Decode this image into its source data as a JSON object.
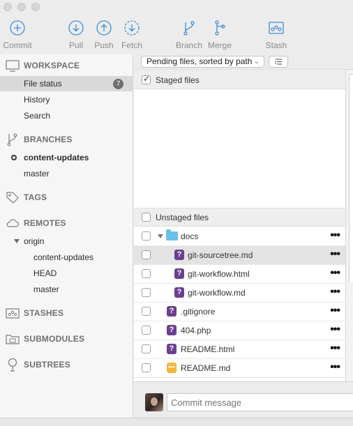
{
  "toolbar": {
    "commit": "Commit",
    "pull": "Pull",
    "push": "Push",
    "fetch": "Fetch",
    "branch": "Branch",
    "merge": "Merge",
    "stash": "Stash"
  },
  "sidebar": {
    "workspace": {
      "title": "WORKSPACE",
      "items": [
        {
          "label": "File status",
          "badge": "7"
        },
        {
          "label": "History"
        },
        {
          "label": "Search"
        }
      ]
    },
    "branches": {
      "title": "BRANCHES",
      "items": [
        {
          "label": "content-updates",
          "current": true
        },
        {
          "label": "master"
        }
      ]
    },
    "tags": {
      "title": "TAGS"
    },
    "remotes": {
      "title": "REMOTES",
      "origin": "origin",
      "items": [
        {
          "label": "content-updates"
        },
        {
          "label": "HEAD"
        },
        {
          "label": "master"
        }
      ]
    },
    "stashes": {
      "title": "STASHES"
    },
    "submodules": {
      "title": "SUBMODULES"
    },
    "subtrees": {
      "title": "SUBTREES"
    }
  },
  "main": {
    "sort_label": "Pending files, sorted by path",
    "staged_title": "Staged files",
    "unstaged_title": "Unstaged files",
    "files": [
      {
        "name": "docs",
        "type": "folder"
      },
      {
        "name": "git-sourcetree.md",
        "status": "?"
      },
      {
        "name": "git-workflow.html",
        "status": "?"
      },
      {
        "name": "git-workflow.md",
        "status": "?"
      },
      {
        "name": ".gitignore",
        "status": "?"
      },
      {
        "name": "404.php",
        "status": "?"
      },
      {
        "name": "README.html",
        "status": "?"
      },
      {
        "name": "README.md",
        "status": "•••"
      }
    ],
    "more_icon": "•••",
    "commit_placeholder": "Commit message"
  },
  "colors": {
    "untracked_badge": "#6c3f8f",
    "modified_badge": "#f5b63d",
    "toolbar_icon": "#3b8fd6",
    "folder": "#6bc0ea"
  }
}
